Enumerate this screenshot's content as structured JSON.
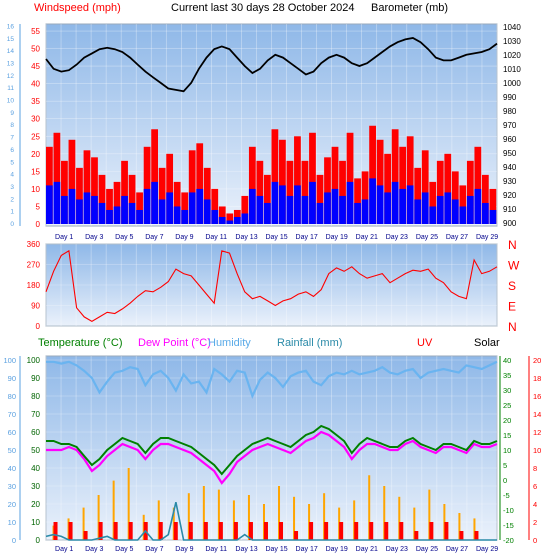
{
  "header": {
    "windspeed_label": "Windspeed (mph)",
    "title": "Current last 30 days 28 October 2024",
    "barometer_label": "Barometer (mb)"
  },
  "colors": {
    "background": "#ffffff",
    "plot_top": "#8fb8e8",
    "plot_bottom": "#eaf1fb",
    "wind_avg": "#0000ff",
    "wind_gust": "#ff0000",
    "wind_flat_blue": "#6aa0f0",
    "barometer": "#000000",
    "direction": "#ff0000",
    "temperature": "#008000",
    "dewpoint": "#ff00ff",
    "humidity": "#6ab4f0",
    "rainfall": "#2a8aa8",
    "uv": "#ff0000",
    "solar": "#ffa500",
    "left_axis_text": "#ff0000",
    "left_axis_secondary": "#5aa0e0",
    "right_axis_rain": "#008000",
    "right_axis_uv": "#ff0000",
    "date_text": "#00008b"
  },
  "legend_bottom": {
    "temperature": "Temperature (°C)",
    "dewpoint": "Dew Point (°C)",
    "humidity": "Humidity",
    "rainfall": "Rainfall (mm)",
    "uv": "UV",
    "solar": "Solar"
  },
  "chart_data": [
    {
      "type": "line",
      "name": "wind_barometer",
      "x_tick_labels": [
        "Day 1",
        "Day 3",
        "Day 5",
        "Day 7",
        "Day 9",
        "Day 11",
        "Day 13",
        "Day 15",
        "Day 17",
        "Day 19",
        "Day 21",
        "Day 23",
        "Day 25",
        "Day 27",
        "Day 29"
      ],
      "left_axis_ticks": [
        0,
        5,
        10,
        15,
        20,
        25,
        30,
        35,
        40,
        45,
        50,
        55
      ],
      "left_axis_secondary_ticks": [
        0,
        1,
        2,
        3,
        4,
        5,
        6,
        7,
        8,
        9,
        10,
        11,
        12,
        13,
        14,
        15,
        16
      ],
      "right_axis_ticks": [
        900,
        910,
        920,
        930,
        940,
        950,
        960,
        970,
        980,
        990,
        1000,
        1010,
        1020,
        1030,
        1040
      ],
      "ylim_wind": [
        0,
        57
      ],
      "ylim_barometer": [
        900,
        1042
      ],
      "barometer": [
        1017,
        1010,
        1008,
        1009,
        1013,
        1018,
        1021,
        1024,
        1025,
        1024,
        1022,
        1018,
        1013,
        1008,
        1004,
        1000,
        996,
        995,
        994,
        1000,
        1010,
        1018,
        1024,
        1026,
        1024,
        1018,
        1012,
        1007,
        1010,
        1016,
        1020,
        1018,
        1014,
        1010,
        1006,
        1008,
        1014,
        1018,
        1020,
        1018,
        1014,
        1012,
        1014,
        1018,
        1022,
        1026,
        1029,
        1031,
        1032,
        1029,
        1024,
        1018,
        1016,
        1016,
        1018,
        1020,
        1021,
        1022,
        1024,
        1028
      ],
      "gust": [
        22,
        26,
        18,
        24,
        16,
        21,
        19,
        14,
        10,
        12,
        18,
        14,
        9,
        22,
        27,
        16,
        20,
        12,
        9,
        21,
        23,
        16,
        10,
        5,
        3,
        4,
        8,
        22,
        18,
        14,
        27,
        24,
        18,
        25,
        18,
        26,
        14,
        19,
        22,
        18,
        26,
        13,
        15,
        28,
        24,
        20,
        27,
        22,
        25,
        16,
        21,
        12,
        18,
        20,
        15,
        11,
        18,
        22,
        14,
        10
      ],
      "average": [
        11,
        12,
        8,
        10,
        7,
        9,
        8,
        6,
        4,
        5,
        8,
        6,
        4,
        10,
        12,
        7,
        9,
        5,
        4,
        9,
        10,
        7,
        4,
        2,
        1,
        2,
        3,
        10,
        8,
        6,
        12,
        11,
        8,
        11,
        8,
        12,
        6,
        9,
        10,
        8,
        12,
        6,
        7,
        13,
        11,
        9,
        12,
        10,
        11,
        7,
        9,
        5,
        8,
        9,
        7,
        5,
        8,
        10,
        6,
        4
      ]
    },
    {
      "type": "line",
      "name": "wind_direction",
      "left_axis_ticks": [
        0,
        90,
        180,
        270,
        360
      ],
      "right_axis_labels": [
        "N",
        "W",
        "S",
        "E",
        "N"
      ],
      "ylim": [
        0,
        360
      ],
      "direction": [
        150,
        240,
        310,
        330,
        80,
        40,
        20,
        40,
        60,
        55,
        75,
        100,
        130,
        155,
        150,
        170,
        195,
        250,
        230,
        220,
        180,
        140,
        100,
        330,
        320,
        230,
        150,
        120,
        130,
        110,
        90,
        110,
        120,
        140,
        150,
        130,
        160,
        230,
        255,
        240,
        260,
        230,
        210,
        220,
        230,
        190,
        210,
        230,
        245,
        240,
        250,
        210,
        190,
        150,
        130,
        120,
        290,
        230,
        240,
        260
      ]
    },
    {
      "type": "line",
      "name": "temperature_humidity_rain",
      "left_axis_ticks": [
        0,
        10,
        20,
        30,
        40,
        50,
        60,
        70,
        80,
        90,
        100
      ],
      "rain_axis_ticks": [
        -20,
        -15,
        -10,
        -5,
        0,
        5,
        10,
        15,
        20,
        25,
        30,
        35,
        40
      ],
      "uv_axis_ticks": [
        0,
        2,
        4,
        6,
        8,
        10,
        12,
        14,
        16,
        18,
        20
      ],
      "ylim_left": [
        0,
        100
      ],
      "ylim_rain": [
        -20,
        40
      ],
      "ylim_uv": [
        0,
        20
      ],
      "humidity": [
        99,
        99,
        98,
        99,
        97,
        94,
        90,
        82,
        88,
        93,
        94,
        96,
        95,
        86,
        92,
        94,
        90,
        83,
        92,
        87,
        88,
        82,
        95,
        92,
        88,
        94,
        93,
        80,
        89,
        93,
        90,
        85,
        91,
        93,
        94,
        88,
        86,
        91,
        93,
        92,
        94,
        92,
        93,
        94,
        96,
        93,
        92,
        94,
        95,
        90,
        93,
        94,
        95,
        94,
        93,
        97,
        96,
        95,
        97,
        99
      ],
      "temperature": [
        13,
        13,
        12,
        12,
        11,
        8,
        5,
        7,
        10,
        12,
        14,
        13,
        12,
        9,
        12,
        14,
        14,
        13,
        12,
        11,
        9,
        7,
        5,
        2,
        5,
        8,
        10,
        12,
        13,
        14,
        13,
        12,
        11,
        13,
        15,
        16,
        18,
        17,
        15,
        13,
        9,
        12,
        14,
        13,
        12,
        11,
        11,
        13,
        14,
        12,
        11,
        10,
        12,
        12,
        11,
        10,
        13,
        12,
        12,
        13
      ],
      "dewpoint": [
        10,
        10,
        10,
        11,
        10,
        7,
        3,
        5,
        8,
        10,
        12,
        11,
        10,
        7,
        10,
        12,
        12,
        11,
        10,
        9,
        7,
        5,
        3,
        -1,
        2,
        6,
        8,
        10,
        11,
        12,
        11,
        10,
        9,
        11,
        13,
        14,
        16,
        15,
        13,
        11,
        7,
        10,
        12,
        12,
        11,
        10,
        10,
        12,
        13,
        11,
        10,
        9,
        11,
        11,
        10,
        9,
        12,
        11,
        11,
        12
      ],
      "rainfall": [
        2,
        3,
        2,
        0,
        0,
        0,
        0,
        1,
        2,
        0,
        0,
        0,
        0,
        5,
        0,
        0,
        3,
        21,
        0,
        0,
        0,
        0,
        0,
        0,
        0,
        0,
        3,
        0,
        0,
        0,
        0,
        0,
        0,
        0,
        0,
        0,
        0,
        0,
        0,
        0,
        0,
        0,
        0,
        0,
        0,
        0,
        0,
        0,
        0,
        0,
        0,
        0,
        0,
        0,
        0,
        0,
        0,
        0,
        0,
        0
      ],
      "uv_daily": [
        2,
        2,
        1,
        2,
        2,
        2,
        2,
        2,
        2,
        2,
        2,
        2,
        2,
        2,
        2,
        2,
        1,
        2,
        2,
        2,
        2,
        2,
        2,
        2,
        1,
        2,
        2,
        1,
        1
      ],
      "solar_daily": [
        8,
        12,
        18,
        25,
        33,
        40,
        14,
        22,
        18,
        26,
        30,
        28,
        22,
        25,
        20,
        30,
        24,
        20,
        26,
        18,
        22,
        36,
        30,
        24,
        18,
        28,
        20,
        15,
        12
      ]
    }
  ]
}
